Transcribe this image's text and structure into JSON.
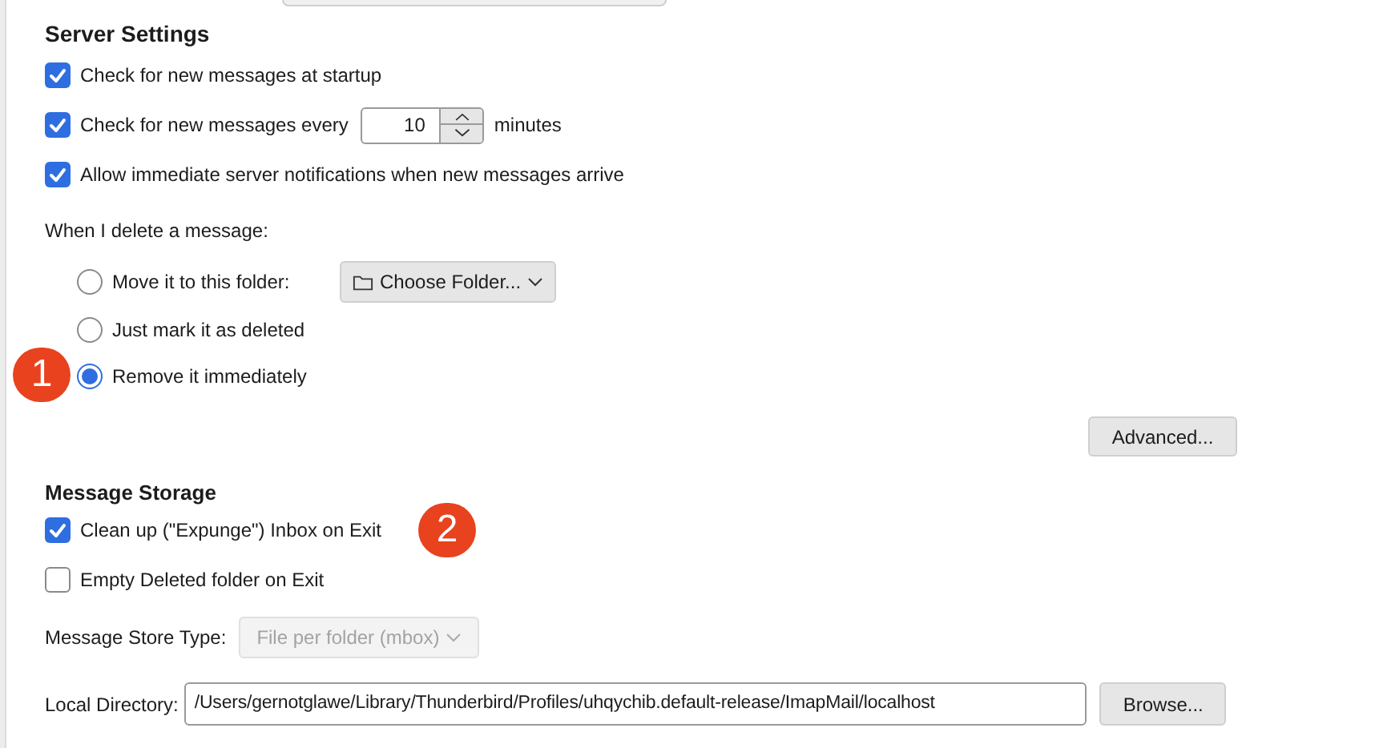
{
  "server_settings": {
    "heading": "Server Settings",
    "checks": [
      {
        "kind": "plain",
        "label": "Check for new messages at startup",
        "checked": true
      },
      {
        "kind": "interval",
        "label": "Check for new messages every",
        "value": "10",
        "suffix": "minutes",
        "checked": true
      },
      {
        "kind": "plain",
        "label": "Allow immediate server notifications when new messages arrive",
        "checked": true
      }
    ]
  },
  "delete_options": {
    "label": "When I delete a message:",
    "options": [
      {
        "label": "Move it to this folder:",
        "selected": false,
        "folder_button": "Choose Folder..."
      },
      {
        "label": "Just mark it as deleted",
        "selected": false
      },
      {
        "label": "Remove it immediately",
        "selected": true,
        "callout": "1"
      }
    ]
  },
  "advanced_button": "Advanced...",
  "message_storage": {
    "heading": "Message Storage",
    "checks": [
      {
        "kind": "plain",
        "label": "Clean up (\"Expunge\") Inbox on Exit",
        "checked": true,
        "callout": "2"
      },
      {
        "kind": "plain",
        "label": "Empty Deleted folder on Exit",
        "checked": false
      }
    ],
    "store_type": {
      "label": "Message Store Type:",
      "value": "File per folder (mbox)",
      "disabled": true
    },
    "local_directory": {
      "label": "Local Directory:",
      "value": "/Users/gernotglawe/Library/Thunderbird/Profiles/uhqychib.default-release/ImapMail/localhost"
    },
    "browse_button": "Browse..."
  }
}
